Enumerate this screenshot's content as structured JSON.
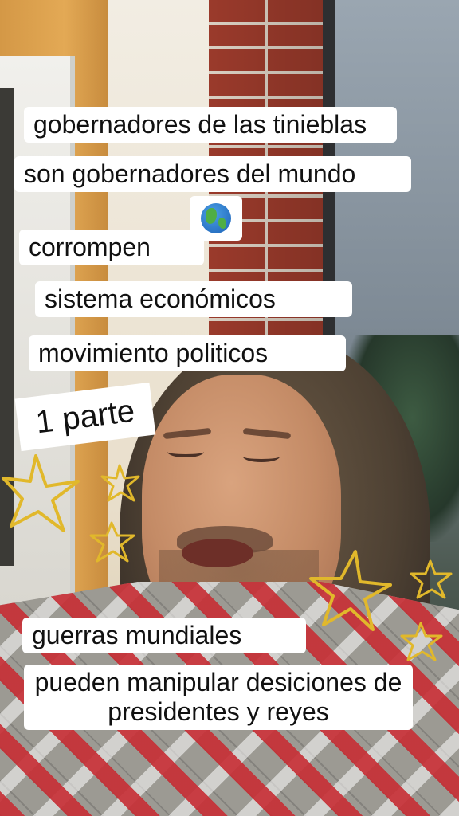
{
  "captions": {
    "line1": "gobernadores de las tinieblas",
    "line2": "son gobernadores del mundo",
    "line3": "corrompen",
    "line4": "sistema económicos",
    "line5": "movimiento politicos",
    "part": "1 parte",
    "line6": "guerras mundiales",
    "line7": "pueden manipular desiciones de presidentes y reyes"
  },
  "emoji": "globe-americas-icon",
  "colors": {
    "caption_bg": "#ffffff",
    "caption_text": "#111111",
    "star_outline": "#e1b82b"
  }
}
